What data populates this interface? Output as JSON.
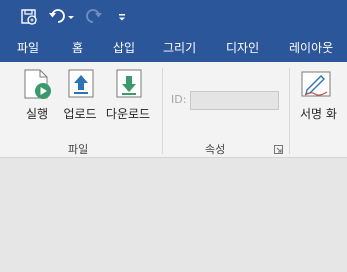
{
  "colors": {
    "brand": "#2b579a",
    "ribbon_bg": "#f3f3f3",
    "workspace": "#e6e6e6"
  },
  "quick_access": {
    "save_icon": "save-icon",
    "undo_icon": "undo-icon",
    "redo_icon": "redo-icon",
    "customize_icon": "customize-quick-access-icon"
  },
  "tabs": [
    {
      "label": "파일"
    },
    {
      "label": "홈"
    },
    {
      "label": "삽입"
    },
    {
      "label": "그리기"
    },
    {
      "label": "디자인"
    },
    {
      "label": "레이아웃"
    }
  ],
  "ribbon": {
    "file_group": {
      "label": "파일",
      "buttons": [
        {
          "label": "실행",
          "icon": "run-document-icon"
        },
        {
          "label": "업로드",
          "icon": "upload-icon"
        },
        {
          "label": "다운로드",
          "icon": "download-icon"
        }
      ]
    },
    "properties_group": {
      "label": "속성",
      "id_label": "ID:",
      "id_value": ""
    },
    "sign_group": {
      "buttons": [
        {
          "label": "서명 화",
          "icon": "signature-pen-icon"
        }
      ]
    }
  }
}
